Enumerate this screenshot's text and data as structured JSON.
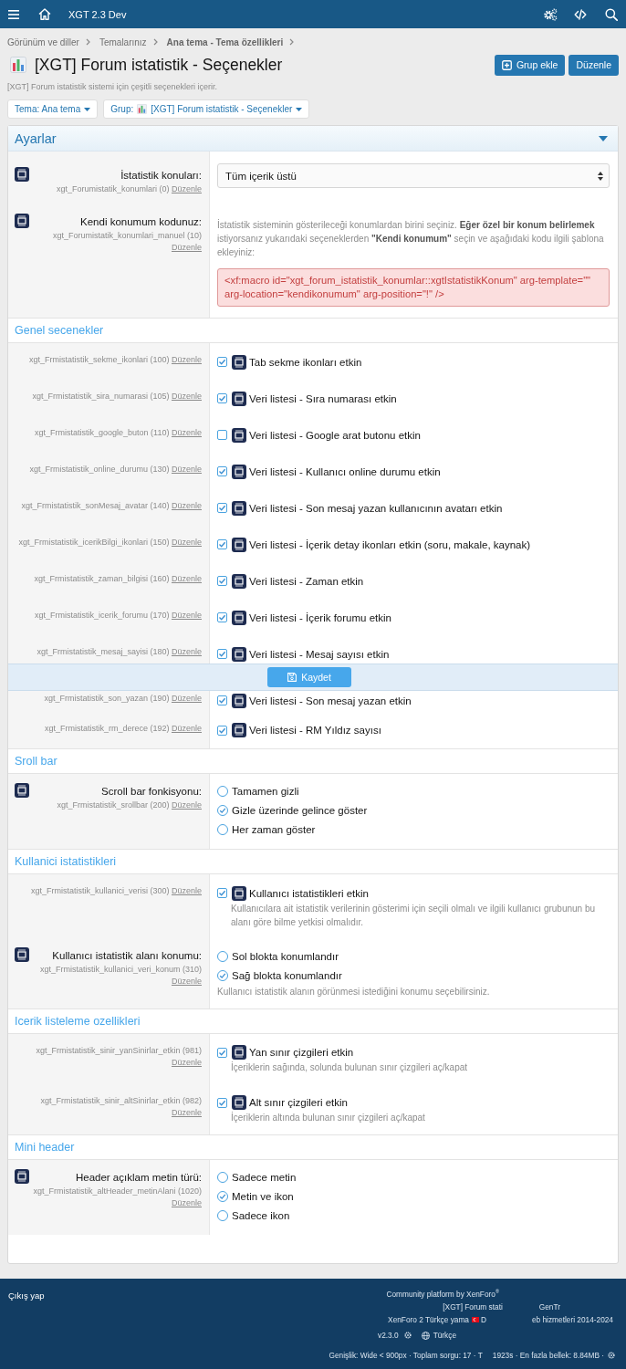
{
  "top_bar": {
    "title": "XGT 2.3 Dev"
  },
  "breadcrumbs": [
    {
      "label": "Görünüm ve diller",
      "current": false
    },
    {
      "label": "Temalarınız",
      "current": false
    },
    {
      "label": "Ana tema - Tema özellikleri",
      "current": true
    }
  ],
  "page": {
    "title": "[XGT] Forum istatistik - Seçenekler",
    "description": "[XGT] Forum istatistik sistemi için çeşitli seçenekleri içerir.",
    "buttons": [
      {
        "kind": "add",
        "label": "Grup ekle"
      },
      {
        "kind": "plain",
        "label": "Düzenle"
      }
    ]
  },
  "filters": [
    {
      "kind": "plain",
      "label": "Tema: Ana tema"
    },
    {
      "kind": "group",
      "prefix": "Grup:",
      "label": "[XGT] Forum istatistik - Seçenekler"
    }
  ],
  "sections": [
    {
      "kind": "main",
      "title": "Ayarlar",
      "rows": [
        {
          "kind": "select",
          "label": "İstatistik konuları:",
          "option": "xgt_Forumistatik_konumlari (0)",
          "edit": "Düzenle",
          "value": "Tüm içerik üstü"
        },
        {
          "kind": "code",
          "label": "Kendi konumum kodunuz:",
          "option": "xgt_Forumistatik_konumlari_manuel (10)",
          "edit": "Düzenle",
          "explain": "İstatistik sisteminin gösterileceği konumlardan birini seçiniz. **Eğer özel bir konum belirlemek** istiyorsanız yukarıdaki seçeneklerden **\"Kendi konumum\"** seçin ve aşağıdaki kodu ilgili şablona ekleyiniz:",
          "code": "<xf:macro id=\"xgt_forum_istatistik_konumlar::xgtIstatistikKonum\" arg-template=\"\" arg-location=\"kendikonumum\" arg-position=\"!\" />"
        }
      ]
    },
    {
      "kind": "sub",
      "title": "Genel secenekler",
      "rows": [
        {
          "kind": "checkbox",
          "option": "xgt_Frmistatistik_sekme_ikonlari (100)",
          "edit": "Düzenle",
          "text": "Tab sekme ikonları etkin",
          "checked": true
        },
        {
          "kind": "checkbox",
          "option": "xgt_Frmistatistik_sira_numarasi (105)",
          "edit": "Düzenle",
          "text": "Veri listesi - Sıra numarası etkin",
          "checked": true
        },
        {
          "kind": "checkbox",
          "option": "xgt_Frmistatistik_google_buton (110)",
          "edit": "Düzenle",
          "text": "Veri listesi - Google arat butonu etkin",
          "checked": false
        },
        {
          "kind": "checkbox",
          "option": "xgt_Frmistatistik_online_durumu (130)",
          "edit": "Düzenle",
          "text": "Veri listesi - Kullanıcı online durumu etkin",
          "checked": true
        },
        {
          "kind": "checkbox",
          "option": "xgt_Frmistatistik_sonMesaj_avatar (140)",
          "edit": "Düzenle",
          "text": "Veri listesi - Son mesaj yazan kullanıcının avatarı etkin",
          "checked": true
        },
        {
          "kind": "checkbox",
          "option": "xgt_Frmistatistik_icerikBilgi_ikonlari (150)",
          "edit": "Düzenle",
          "text": "Veri listesi - İçerik detay ikonları etkin (soru, makale, kaynak)",
          "checked": true
        },
        {
          "kind": "checkbox",
          "option": "xgt_Frmistatistik_zaman_bilgisi (160)",
          "edit": "Düzenle",
          "text": "Veri listesi - Zaman etkin",
          "checked": true
        },
        {
          "kind": "checkbox",
          "option": "xgt_Frmistatistik_icerik_forumu (170)",
          "edit": "Düzenle",
          "text": "Veri listesi - İçerik forumu etkin",
          "checked": true
        },
        {
          "kind": "checkbox",
          "option": "xgt_Frmistatistik_mesaj_sayisi (180)",
          "edit": "Düzenle",
          "text": "Veri listesi - Mesaj sayısı etkin",
          "checked": true
        },
        {
          "kind": "save",
          "label": "Kaydet"
        },
        {
          "kind": "checkbox",
          "option": "xgt_Frmistatistik_son_yazan (190)",
          "edit": "Düzenle",
          "text": "Veri listesi - Son mesaj yazan etkin",
          "checked": true
        },
        {
          "kind": "checkbox",
          "option": "xgt_Frmistatistik_rm_derece (192)",
          "edit": "Düzenle",
          "text": "Veri listesi - RM Yıldız sayısı",
          "checked": true
        }
      ]
    },
    {
      "kind": "sub",
      "title": "Sroll bar",
      "rows": [
        {
          "kind": "radio",
          "label": "Scroll bar fonkisyonu:",
          "option": "xgt_Frmistatistik_srollbar (200)",
          "edit": "Düzenle",
          "options": [
            {
              "label": "Tamamen gizli",
              "selected": false
            },
            {
              "label": "Gizle üzerinde gelince göster",
              "selected": true
            },
            {
              "label": "Her zaman göster",
              "selected": false
            }
          ]
        }
      ]
    },
    {
      "kind": "sub",
      "title": "Kullanici istatistikleri",
      "rows": [
        {
          "kind": "checkbox",
          "option": "xgt_Frmistatistik_kullanici_verisi (300)",
          "edit": "Düzenle",
          "text": "Kullanıcı istatistikleri etkin",
          "checked": true,
          "explain": "Kullanıcılara ait istatistik verilerinin gösterimi için seçili olmalı ve ilgili kullanıcı grubunun bu alanı göre bilme yetkisi olmalıdır."
        },
        {
          "kind": "radio",
          "label": "Kullanıcı istatistik alanı konumu:",
          "option": "xgt_Frmistatistik_kullanici_veri_konum (310)",
          "edit": "Düzenle",
          "options": [
            {
              "label": "Sol blokta konumlandır",
              "selected": false
            },
            {
              "label": "Sağ blokta konumlandır",
              "selected": true
            }
          ],
          "explain": "Kullanıcı istatistik alanın görünmesi istediğini konumu seçebilirsiniz."
        }
      ]
    },
    {
      "kind": "sub",
      "title": "Icerik listeleme ozellikleri",
      "rows": [
        {
          "kind": "checkbox",
          "option": "xgt_Frmistatistik_sinir_yanSinirlar_etkin (981)",
          "edit": "Düzenle",
          "text": "Yan sınır çizgileri etkin",
          "checked": true,
          "explain": "İçeriklerin sağında, solunda bulunan sınır çizgileri aç/kapat"
        },
        {
          "kind": "checkbox",
          "option": "xgt_Frmistatistik_sinir_altSinirlar_etkin (982)",
          "edit": "Düzenle",
          "text": "Alt sınır çizgileri etkin",
          "checked": true,
          "explain": "İçeriklerin altında bulunan sınır çizgileri aç/kapat"
        }
      ]
    },
    {
      "kind": "sub",
      "title": "Mini header",
      "rows": [
        {
          "kind": "radio",
          "label": "Header açıklam metin türü:",
          "option": "xgt_Frmistatistik_altHeader_metinAlani (1020)",
          "edit": "Düzenle",
          "options": [
            {
              "label": "Sadece metin",
              "selected": false
            },
            {
              "label": "Metin ve ikon",
              "selected": true
            },
            {
              "label": "Sadece ikon",
              "selected": false
            }
          ]
        }
      ]
    }
  ],
  "footer": {
    "logout": "Çıkış yap",
    "platform_credit": "Community platform by XenForo$^{®}$",
    "addon_credit": [
      "[XGT] Forum stati",
      "GenTr"
    ],
    "translation_credit": [
      "XenForo 2 Türkçe yama",
      "D",
      "eb hizmetleri 2014-2024"
    ],
    "version": "v2.3.0",
    "language": "Türkçe",
    "debug_info": [
      "Genişlik: Wide < 900px · Toplam sorgu: 17 · T",
      "1923s · En fazla bellek: 8.84MB ·"
    ]
  }
}
